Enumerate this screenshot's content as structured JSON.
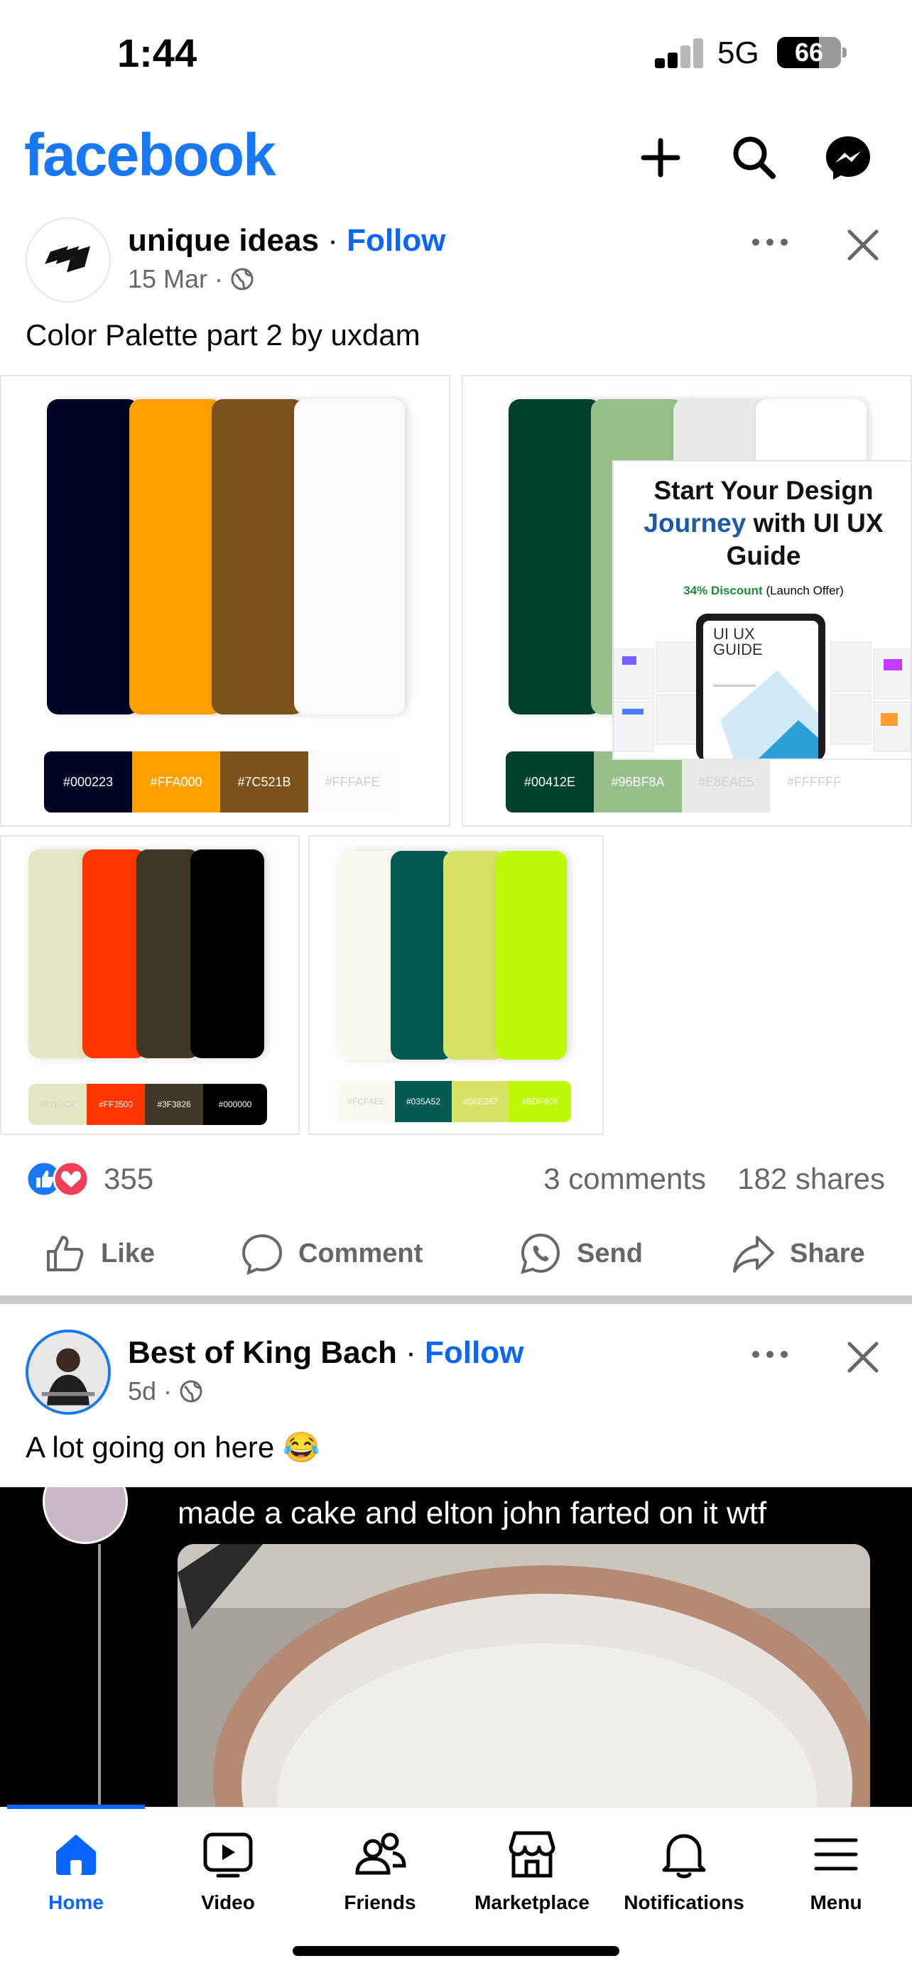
{
  "status_bar": {
    "time": "1:44",
    "network": "5G",
    "battery": "66",
    "battery_level": 0.66
  },
  "header": {
    "logo": "facebook",
    "icons": [
      "plus-icon",
      "search-icon",
      "messenger-icon"
    ]
  },
  "post1": {
    "author": "unique ideas",
    "separator": "·",
    "follow": "Follow",
    "date": "15 Mar",
    "dot": "·",
    "caption": "Color Palette part 2 by uxdam",
    "palettes": [
      {
        "colors": [
          "#000223",
          "#FFA000",
          "#7C521B",
          "#FFFAFE"
        ],
        "codes": [
          "#000223",
          "#FFA000",
          "#7C521B",
          "#FFFAFE"
        ]
      },
      {
        "colors": [
          "#00412E",
          "#96BF8A",
          "#E8EAE5",
          "#FFFFFF"
        ],
        "codes": [
          "#00412E",
          "#96BF8A",
          "#E8EAE5",
          "#FFFFFF"
        ]
      },
      {
        "colors": [
          "#E7E6C4",
          "#FF3500",
          "#3F3826",
          "#000000"
        ],
        "codes": [
          "#E7E6C4",
          "#FF3500",
          "#3F3826",
          "#000000"
        ]
      },
      {
        "colors": [
          "#FCFAEE",
          "#035A52",
          "#D8E267",
          "#BDF806"
        ],
        "codes": [
          "#FCFAEE",
          "#035A52",
          "#D8E267",
          "#BDF806"
        ]
      }
    ],
    "ad": {
      "title_line1": "Start Your Design",
      "title_blue": "Journey",
      "title_line2_rest": " with UI UX",
      "title_line3": "Guide",
      "discount": "34% Discount",
      "discount_note": " (Launch Offer)",
      "tablet_title_1": "UI UX",
      "tablet_title_2": "GUIDE"
    },
    "reaction_count": "355",
    "comments": "3 comments",
    "shares": "182 shares"
  },
  "actions": {
    "like": "Like",
    "comment": "Comment",
    "send": "Send",
    "share": "Share"
  },
  "post2": {
    "author": "Best of King Bach",
    "separator": "·",
    "follow": "Follow",
    "date": "5d",
    "dot": "·",
    "caption": "A lot going on here 😂",
    "video_text": "made a cake and elton john farted on it wtf"
  },
  "tabbar": {
    "items": [
      {
        "label": "Home",
        "icon": "home-icon",
        "active": true
      },
      {
        "label": "Video",
        "icon": "video-icon"
      },
      {
        "label": "Friends",
        "icon": "friends-icon"
      },
      {
        "label": "Marketplace",
        "icon": "marketplace-icon"
      },
      {
        "label": "Notifications",
        "icon": "bell-icon"
      },
      {
        "label": "Menu",
        "icon": "menu-icon"
      }
    ]
  },
  "colors": {
    "brand": "#1877F2",
    "link": "#0866FF",
    "muted": "#65676B"
  }
}
